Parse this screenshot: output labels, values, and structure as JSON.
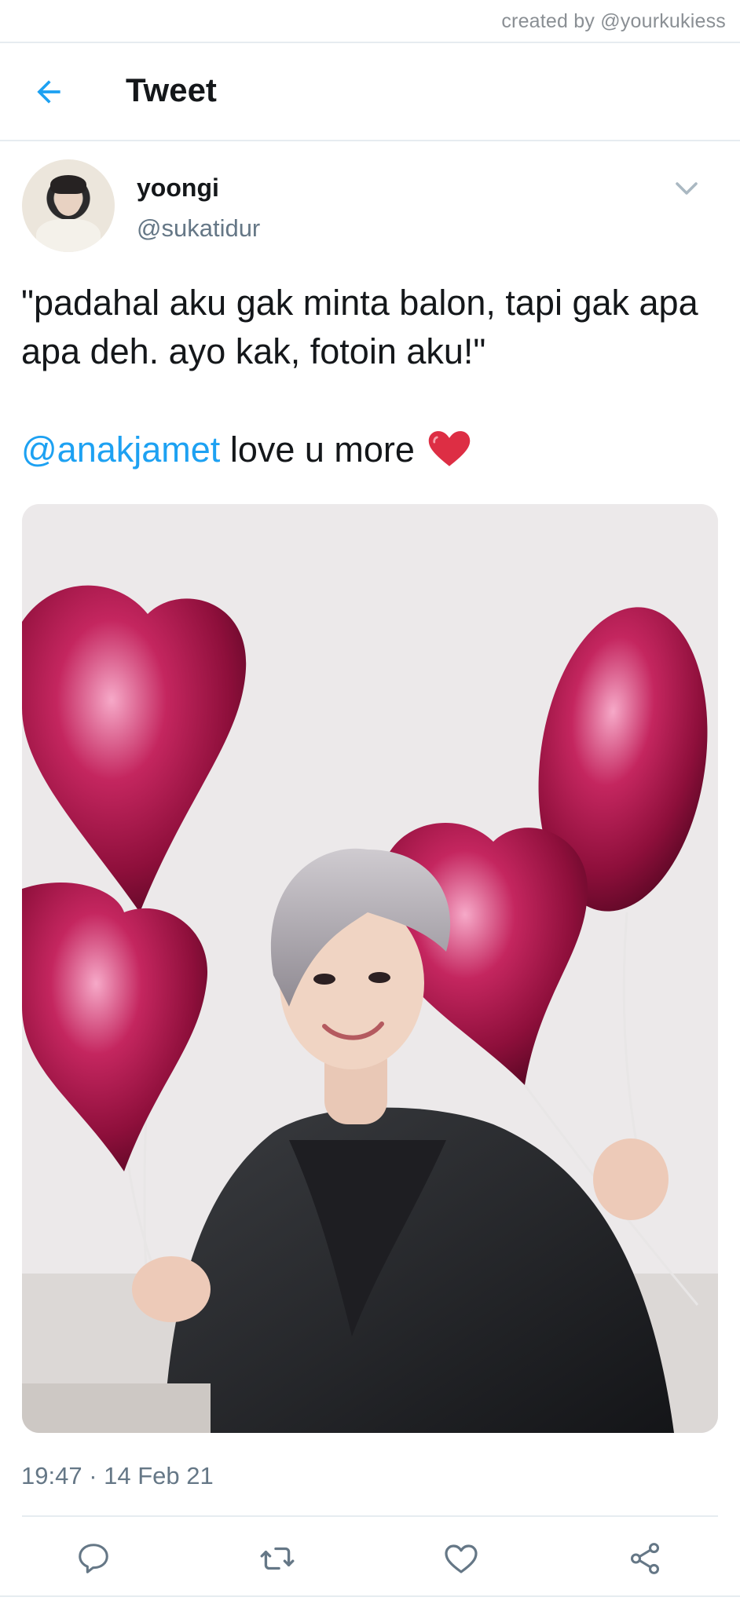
{
  "credit": {
    "text": "created by @yourkukiess"
  },
  "header": {
    "title": "Tweet",
    "back_icon": "arrow-left-icon"
  },
  "author": {
    "name": "yoongi",
    "handle": "@sukatidur"
  },
  "tweet": {
    "text": "\"padahal aku gak minta balon, tapi gak apa apa deh. ayo kak, fotoin aku!\"",
    "mention": "@anakjamet",
    "after_mention": " love u more",
    "emoji": "red-heart-emoji"
  },
  "media": {
    "description_icon": "photo"
  },
  "meta": {
    "timestamp": "19:47 · 14 Feb 21"
  },
  "actions": [
    {
      "name": "reply",
      "icon": "reply-icon"
    },
    {
      "name": "retweet",
      "icon": "retweet-icon"
    },
    {
      "name": "like",
      "icon": "heart-icon"
    },
    {
      "name": "share",
      "icon": "share-icon"
    }
  ],
  "colors": {
    "accent": "#1da1f2",
    "secondary_text": "#657786",
    "primary_text": "#14171a",
    "divider": "#e6ecf0"
  }
}
